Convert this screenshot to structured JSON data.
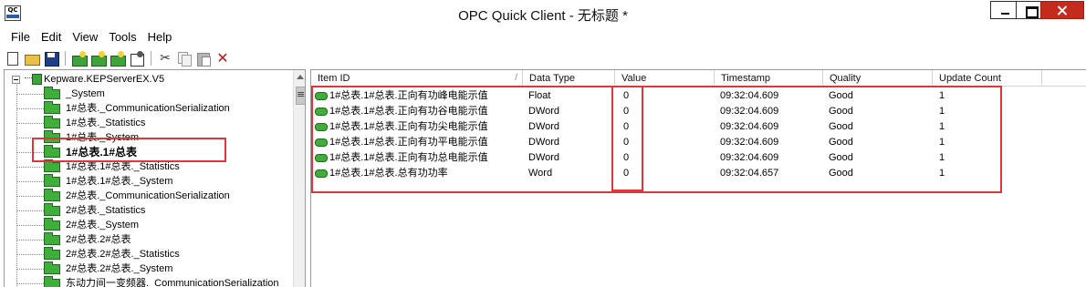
{
  "window": {
    "icon_text": "QC",
    "title": "OPC Quick Client - 无标题 *"
  },
  "menu": [
    "File",
    "Edit",
    "View",
    "Tools",
    "Help"
  ],
  "toolbar": {
    "cut_glyph": "✂",
    "delete_glyph": "✕"
  },
  "tree": {
    "root": "Kepware.KEPServerEX.V5",
    "items": [
      "_System",
      "1#总表._CommunicationSerialization",
      "1#总表._Statistics",
      "1#总表._System",
      "1#总表.1#总表",
      "1#总表.1#总表._Statistics",
      "1#总表.1#总表._System",
      "2#总表._CommunicationSerialization",
      "2#总表._Statistics",
      "2#总表._System",
      "2#总表.2#总表",
      "2#总表.2#总表._Statistics",
      "2#总表.2#总表._System",
      "东动力间一变频器._CommunicationSerialization"
    ],
    "selected_index": 4
  },
  "list": {
    "columns": [
      "Item ID",
      "Data Type",
      "Value",
      "Timestamp",
      "Quality",
      "Update Count"
    ],
    "rows": [
      {
        "item_id": "1#总表.1#总表.正向有功峰电能示值",
        "data_type": "Float",
        "value": "0",
        "timestamp": "09:32:04.609",
        "quality": "Good",
        "update_count": "1"
      },
      {
        "item_id": "1#总表.1#总表.正向有功谷电能示值",
        "data_type": "DWord",
        "value": "0",
        "timestamp": "09:32:04.609",
        "quality": "Good",
        "update_count": "1"
      },
      {
        "item_id": "1#总表.1#总表.正向有功尖电能示值",
        "data_type": "DWord",
        "value": "0",
        "timestamp": "09:32:04.609",
        "quality": "Good",
        "update_count": "1"
      },
      {
        "item_id": "1#总表.1#总表.正向有功平电能示值",
        "data_type": "DWord",
        "value": "0",
        "timestamp": "09:32:04.609",
        "quality": "Good",
        "update_count": "1"
      },
      {
        "item_id": "1#总表.1#总表.正向有功总电能示值",
        "data_type": "DWord",
        "value": "0",
        "timestamp": "09:32:04.609",
        "quality": "Good",
        "update_count": "1"
      },
      {
        "item_id": "1#总表.1#总表.总有功功率",
        "data_type": "Word",
        "value": "0",
        "timestamp": "09:32:04.657",
        "quality": "Good",
        "update_count": "1"
      }
    ]
  },
  "colors": {
    "highlight_box": "#e0353b",
    "tag_green": "#3fae3a",
    "close_button": "#c42b1c"
  }
}
